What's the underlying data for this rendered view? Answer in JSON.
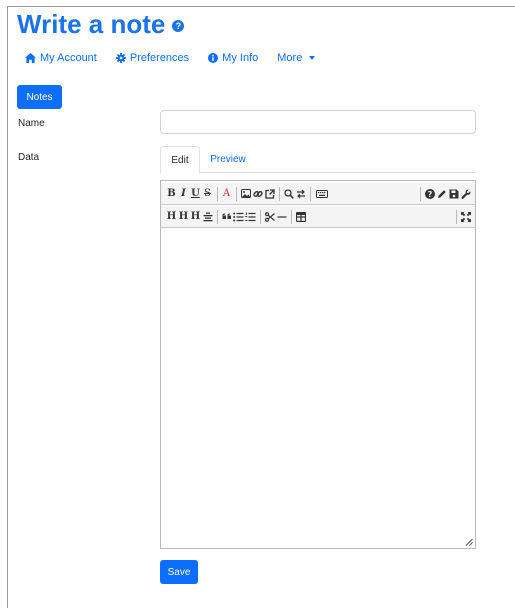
{
  "page": {
    "title": "Write a note"
  },
  "nav": {
    "items": [
      {
        "label": "My Account",
        "icon": "home-icon"
      },
      {
        "label": "Preferences",
        "icon": "gear-icon"
      },
      {
        "label": "My Info",
        "icon": "info-icon"
      },
      {
        "label": "More",
        "icon": "caret-down-icon"
      }
    ]
  },
  "form": {
    "notes_button": "Notes",
    "name_label": "Name",
    "name_value": "",
    "data_label": "Data",
    "tabs": [
      {
        "label": "Edit",
        "active": true
      },
      {
        "label": "Preview",
        "active": false
      }
    ],
    "save_button": "Save"
  },
  "toolbar": {
    "row1": [
      "bold-icon",
      "italic-icon",
      "underline-icon",
      "strikethrough-icon",
      "text-color-icon",
      "image-icon",
      "link-icon",
      "external-link-icon",
      "search-icon",
      "replace-icon",
      "keyboard-icon",
      "help-icon",
      "pencil-icon",
      "save-icon",
      "wrench-icon"
    ],
    "row2": [
      "heading-1-icon",
      "heading-2-icon",
      "heading-3-icon",
      "align-center-icon",
      "quote-icon",
      "bullet-list-icon",
      "numbered-list-icon",
      "scissors-icon",
      "horizontal-rule-icon",
      "table-icon",
      "fullscreen-icon"
    ],
    "glyphs": {
      "bold": "B",
      "italic": "I",
      "underline": "U",
      "strike": "S",
      "color": "A",
      "heading": "H"
    }
  },
  "colors": {
    "accent": "#0d6efd",
    "title": "#1a73e8",
    "color_tool": "#d62828"
  }
}
